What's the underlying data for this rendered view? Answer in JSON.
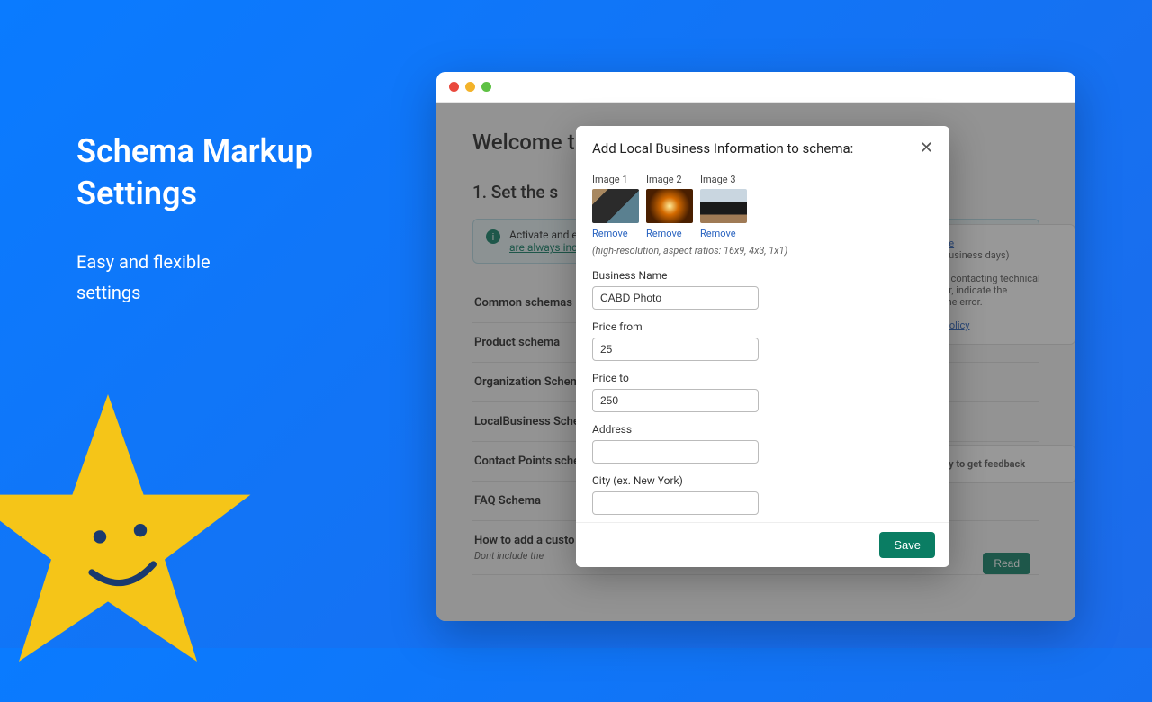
{
  "promo": {
    "title_line1": "Schema Markup",
    "title_line2": "Settings",
    "subtitle_line1": "Easy and flexible",
    "subtitle_line2": "settings"
  },
  "page": {
    "welcome": "Welcome t",
    "step1": "1. Set the s",
    "alert_text": "Activate and edit",
    "alert_link": "are always includ",
    "schemas": [
      "Common schemas (",
      "Product schema",
      "Organization Schem",
      "LocalBusiness Schem",
      "Contact Points sche",
      "FAQ Schema"
    ],
    "custom_title": "How to add a custo",
    "custom_sub": "Dont include the",
    "read_btn": "Read",
    "side1_a": "ite",
    "side1_b": "business days)",
    "side2_a": "e contacting technical",
    "side2_b": "or, indicate the",
    "side2_c": "the error.",
    "side2_link": "Policy",
    "side3": "py to get feedback"
  },
  "modal": {
    "title": "Add Local Business Information to schema:",
    "img_labels": [
      "Image 1",
      "Image 2",
      "Image 3"
    ],
    "remove": "Remove",
    "hint": "(high-resolution, aspect ratios: 16x9, 4x3, 1x1)",
    "fields": {
      "business_name_label": "Business Name",
      "business_name_value": "CABD Photo",
      "price_from_label": "Price from",
      "price_from_value": "25",
      "price_to_label": "Price to",
      "price_to_value": "250",
      "address_label": "Address",
      "address_value": "",
      "city_label": "City (ex. New York)",
      "city_value": ""
    },
    "save": "Save"
  }
}
